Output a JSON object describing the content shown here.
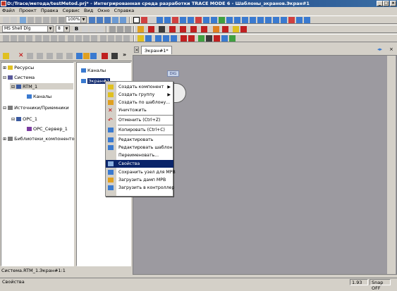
{
  "window": {
    "title": "D:/Trace/метода/testMetod.prj* - Интегрированная среда разработки TRACE MODE 6 - Шаблоны_экранов.Экран#1"
  },
  "menu": [
    "Файл",
    "Проект",
    "Правка",
    "Сервис",
    "Вид",
    "Окно",
    "Справка"
  ],
  "toolbar": {
    "zoom": "100%",
    "font": "MS Shell Dlg",
    "font_size": "8"
  },
  "left_tree": [
    {
      "label": "Ресурсы"
    },
    {
      "label": "Система"
    },
    {
      "label": "RTM_1"
    },
    {
      "label": "Каналы"
    },
    {
      "label": "Источники/Приемники"
    },
    {
      "label": "OPC_1"
    },
    {
      "label": "OPC_Сервер_1"
    },
    {
      "label": "Библиотеки_компонентов"
    }
  ],
  "mid_tree": [
    {
      "label": "Каналы"
    },
    {
      "label": "Экран#1"
    }
  ],
  "editor": {
    "tab": "Экран#1*",
    "dig_label": "DIG"
  },
  "context_menu": [
    {
      "label": "Создать компонент",
      "submenu": true
    },
    {
      "label": "Создать группу",
      "submenu": true
    },
    {
      "label": "Создать по шаблону..."
    },
    {
      "label": "Уничтожить"
    },
    {
      "label": "Отменить (Ctrl+Z)"
    },
    {
      "label": "Копировать (Ctrl+C)"
    },
    {
      "label": "Редактировать"
    },
    {
      "label": "Редактировать шаблон"
    },
    {
      "label": "Переименовать..."
    },
    {
      "label": "Свойства",
      "selected": true
    },
    {
      "label": "Сохранить узел для МРВ"
    },
    {
      "label": "Загрузить дамп МРВ"
    },
    {
      "label": "Загрузить в контроллер"
    }
  ],
  "path_bar": "Система.RTM_1.Экран#1:1",
  "status": {
    "left": "Свойства",
    "version": "1.93",
    "snap": "Snap OFF"
  },
  "colors": {
    "title": "#0a246a",
    "canvas": "#9c9aa0",
    "selection": "#0a246a"
  }
}
